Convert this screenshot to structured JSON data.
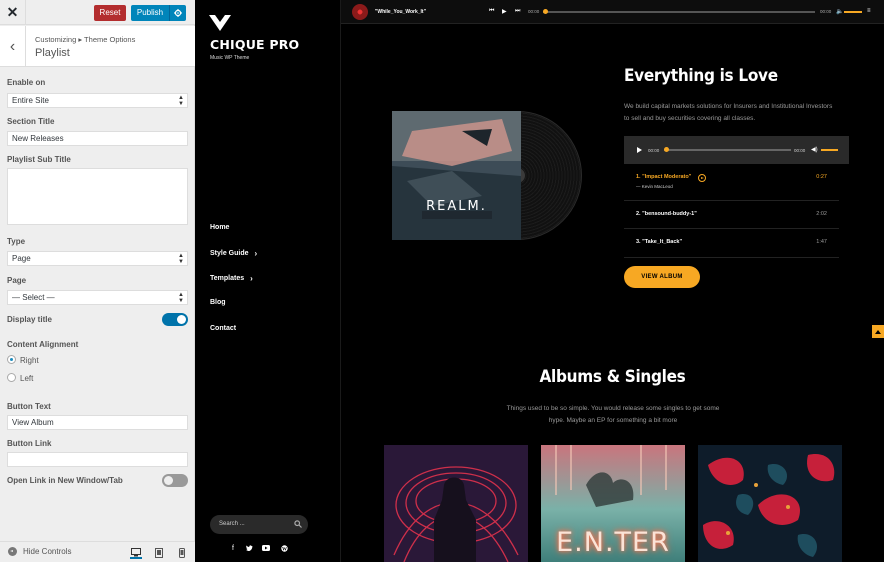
{
  "customizer": {
    "reset_label": "Reset",
    "publish_label": "Publish",
    "breadcrumb": "Customizing ▸ Theme Options",
    "section_heading": "Playlist",
    "enable_on": {
      "label": "Enable on",
      "value": "Entire Site"
    },
    "section_title": {
      "label": "Section Title",
      "value": "New Releases"
    },
    "playlist_sub_title": {
      "label": "Playlist Sub Title",
      "value": ""
    },
    "type": {
      "label": "Type",
      "value": "Page"
    },
    "page": {
      "label": "Page",
      "value": "— Select —"
    },
    "display_title": {
      "label": "Display title",
      "enabled": true
    },
    "content_alignment": {
      "label": "Content Alignment",
      "options": [
        "Right",
        "Left"
      ],
      "selected": "Right"
    },
    "button_text": {
      "label": "Button Text",
      "value": "View Album"
    },
    "button_link": {
      "label": "Button Link",
      "value": ""
    },
    "open_new_tab": {
      "label": "Open Link in New Window/Tab",
      "enabled": false
    },
    "hide_controls": "Hide Controls",
    "devices": [
      "desktop-icon",
      "tablet-icon",
      "mobile-icon"
    ]
  },
  "site": {
    "title": "CHIQUE PRO",
    "tagline": "Music WP Theme",
    "nav": [
      {
        "label": "Home",
        "has_submenu": false
      },
      {
        "label": "Style Guide",
        "has_submenu": true
      },
      {
        "label": "Templates",
        "has_submenu": true
      },
      {
        "label": "Blog",
        "has_submenu": false
      },
      {
        "label": "Contact",
        "has_submenu": false
      }
    ],
    "search_placeholder": "Search ...",
    "social_icons": [
      "facebook-icon",
      "twitter-icon",
      "youtube-icon",
      "wordpress-icon"
    ]
  },
  "top_player": {
    "track": "\"While_You_Work_It\"",
    "time_current": "00:00",
    "time_total": "00:00",
    "progress": 0
  },
  "playlist": {
    "title": "Everything is Love",
    "description": "We build capital markets solutions for Insurers and Institutional Investors to sell and buy securities covering all classes.",
    "album_cover_text": "REALM.",
    "audio": {
      "time_current": "00:00",
      "time_total": "00:00",
      "progress": 0
    },
    "tracks": [
      {
        "title": "1. \"Impact Moderato\"",
        "artist": "— Kevin MacLeod",
        "duration": "0:27",
        "active": true
      },
      {
        "title": "2. \"bensound-buddy-1\"",
        "artist": "",
        "duration": "2:02",
        "active": false
      },
      {
        "title": "3. \"Take_It_Back\"",
        "artist": "",
        "duration": "1:47",
        "active": false
      }
    ],
    "button_label": "VIEW ALBUM"
  },
  "albums": {
    "title": "Albums & Singles",
    "description": "Things used to be so simple. You would release some singles to get some hype. Maybe an EP for something a bit more",
    "cards": [
      {
        "art_text": ""
      },
      {
        "art_text": "E.N.TER"
      },
      {
        "art_text": ""
      }
    ]
  },
  "colors": {
    "accent": "#f7a823",
    "wp_blue": "#0085ba",
    "wp_red": "#b32d2e"
  }
}
